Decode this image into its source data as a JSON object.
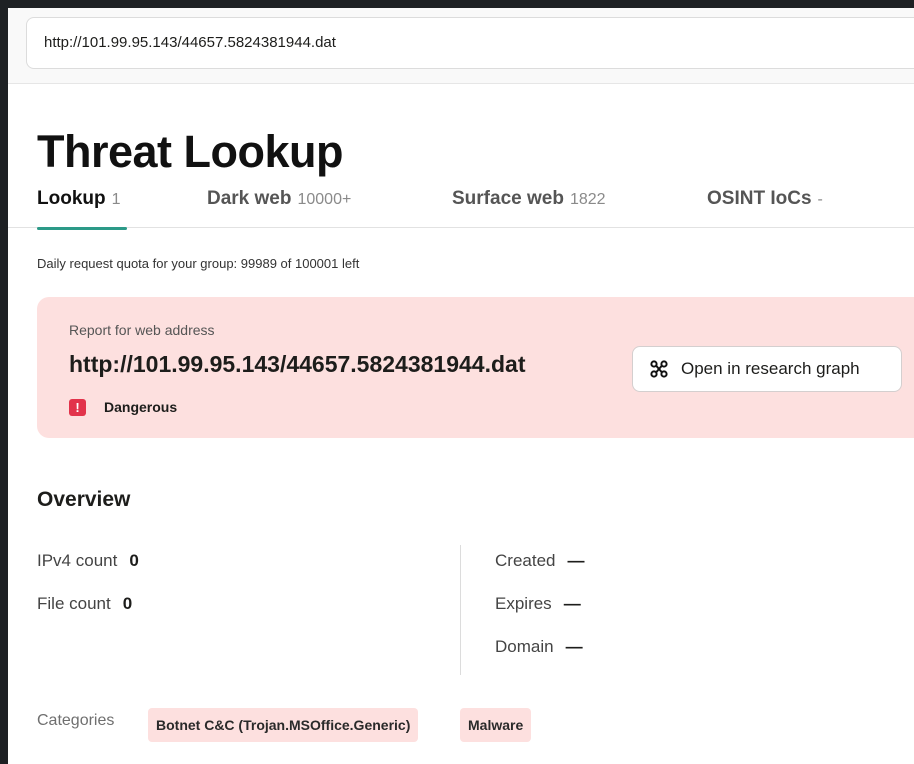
{
  "search": {
    "value": "http://101.99.95.143/44657.5824381944.dat"
  },
  "page": {
    "title": "Threat Lookup"
  },
  "tabs": [
    {
      "label": "Lookup",
      "count": "1",
      "active": true
    },
    {
      "label": "Dark web",
      "count": "10000+",
      "active": false
    },
    {
      "label": "Surface web",
      "count": "1822",
      "active": false
    },
    {
      "label": "OSINT IoCs",
      "count": "-",
      "active": false
    }
  ],
  "quota": {
    "text": "Daily request quota for your group: 99989 of 100001 left"
  },
  "report": {
    "label": "Report for web address",
    "url": "http://101.99.95.143/44657.5824381944.dat",
    "status": "Dangerous",
    "status_icon": "exclamation-icon",
    "status_color": "#e2334b",
    "card_color": "#fde0df",
    "graph_button_label": "Open in research graph",
    "graph_button_icon": "graph-nodes-icon"
  },
  "overview": {
    "title": "Overview",
    "left": [
      {
        "label": "IPv4 count",
        "value": "0"
      },
      {
        "label": "File count",
        "value": "0"
      }
    ],
    "right": [
      {
        "label": "Created",
        "value": "—"
      },
      {
        "label": "Expires",
        "value": "—"
      },
      {
        "label": "Domain",
        "value": "—"
      }
    ]
  },
  "categories": {
    "label": "Categories",
    "items": [
      "Botnet C&C (Trojan.MSOffice.Generic)",
      "Malware"
    ]
  },
  "colors": {
    "accent": "#2c9a88",
    "background": "#1e2124"
  }
}
